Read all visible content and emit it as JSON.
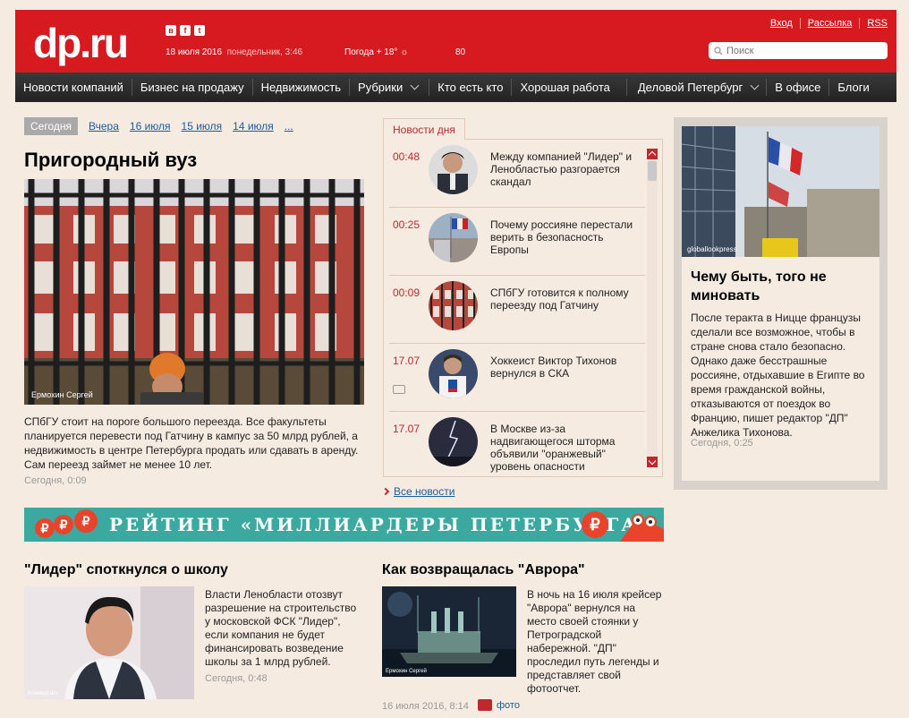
{
  "header": {
    "logo": "dp.ru",
    "social": [
      "в",
      "f",
      "t"
    ],
    "date": "18 июля 2016",
    "weekday_time": "понедельник, 3:46",
    "weather": "Погода + 18°",
    "counter": "80",
    "links": [
      "Вход",
      "Рассылка",
      "RSS"
    ],
    "search_placeholder": "Поиск"
  },
  "nav": {
    "items": [
      {
        "label": "Новости компаний",
        "dropdown": false
      },
      {
        "label": "Бизнес на продажу",
        "dropdown": false
      },
      {
        "label": "Недвижимость",
        "dropdown": false
      },
      {
        "label": "Рубрики",
        "dropdown": true
      },
      {
        "label": "Кто есть кто",
        "dropdown": false
      },
      {
        "label": "Хорошая работа",
        "dropdown": false
      },
      {
        "label": "Деловой Петербург",
        "dropdown": true
      },
      {
        "label": "В офисе",
        "dropdown": false
      },
      {
        "label": "Блоги",
        "dropdown": false
      }
    ]
  },
  "date_tabs": {
    "active": "Сегодня",
    "others": [
      "Вчера",
      "16 июля",
      "15 июля",
      "14 июля",
      "..."
    ]
  },
  "main_story": {
    "title": "Пригородный вуз",
    "photo_credit": "Ермохин Сергей",
    "lead": "СПбГУ стоит на пороге большого переезда. Все факультеты планируется перевести под Гатчину в кампус за 50 млрд рублей, а недвижимость в центре Петербурга продать или сдавать в аренду. Сам переезд займет не менее 10 лет.",
    "time": "Сегодня, 0:09"
  },
  "news_of_day": {
    "tab": "Новости дня",
    "items": [
      {
        "time": "00:48",
        "text": "Между компанией \"Лидер\" и Ленобластью разгорается скандал"
      },
      {
        "time": "00:25",
        "text": "Почему россияне перестали верить в безопасность Европы"
      },
      {
        "time": "00:09",
        "text": "СПбГУ готовится к полному переезду под Гатчину"
      },
      {
        "time": "17.07",
        "text": "Хоккеист Виктор Тихонов вернулся в СКА"
      },
      {
        "time": "17.07",
        "text": "В Москве из-за надвигающегося шторма объявили \"оранжевый\" уровень опасности"
      }
    ],
    "all_news": "Все новости"
  },
  "feature": {
    "image_caption": "globallookpress",
    "title": "Чему быть, того не миновать",
    "lead": "После теракта в Ницце французы сделали все возможное, чтобы в стране снова стало безопасно. Однако даже бесстрашные россияне, отдыхавшие в Египте во время гражданской войны, отказываются от поездок во Францию, пишет редактор \"ДП\" Анжелика Тихонова.",
    "time": "Сегодня, 0:25"
  },
  "banner": {
    "text": "РЕЙТИНГ «МИЛЛИАРДЕРЫ ПЕТЕРБУРГА»",
    "coin_symbol": "₽"
  },
  "bottom_left": {
    "title": "\"Лидер\" споткнулся о школу",
    "photo_credit": "Коммерсант",
    "lead": "Власти Ленобласти отозвут разрешение на строительство у московской ФСК \"Лидер\", если компания не будет финансировать возведение школы за 1 млрд рублей.",
    "time": "Сегодня, 0:48"
  },
  "bottom_right": {
    "title": "Как возвращалась \"Аврора\"",
    "photo_credit": "Ермохин Сергей",
    "lead": "В ночь на 16 июля крейсер \"Аврора\" вернулся на место своей стоянки у Петроградской набережной. \"ДП\" проследил путь легенды и представляет свой фотоотчет.",
    "time": "16 июля 2016, 8:14",
    "photo_label": "фото"
  },
  "colors": {
    "brand_red": "#d71920",
    "background": "#f5ebe1",
    "link": "#1b5c9e",
    "banner_teal": "#3ba9a0"
  }
}
